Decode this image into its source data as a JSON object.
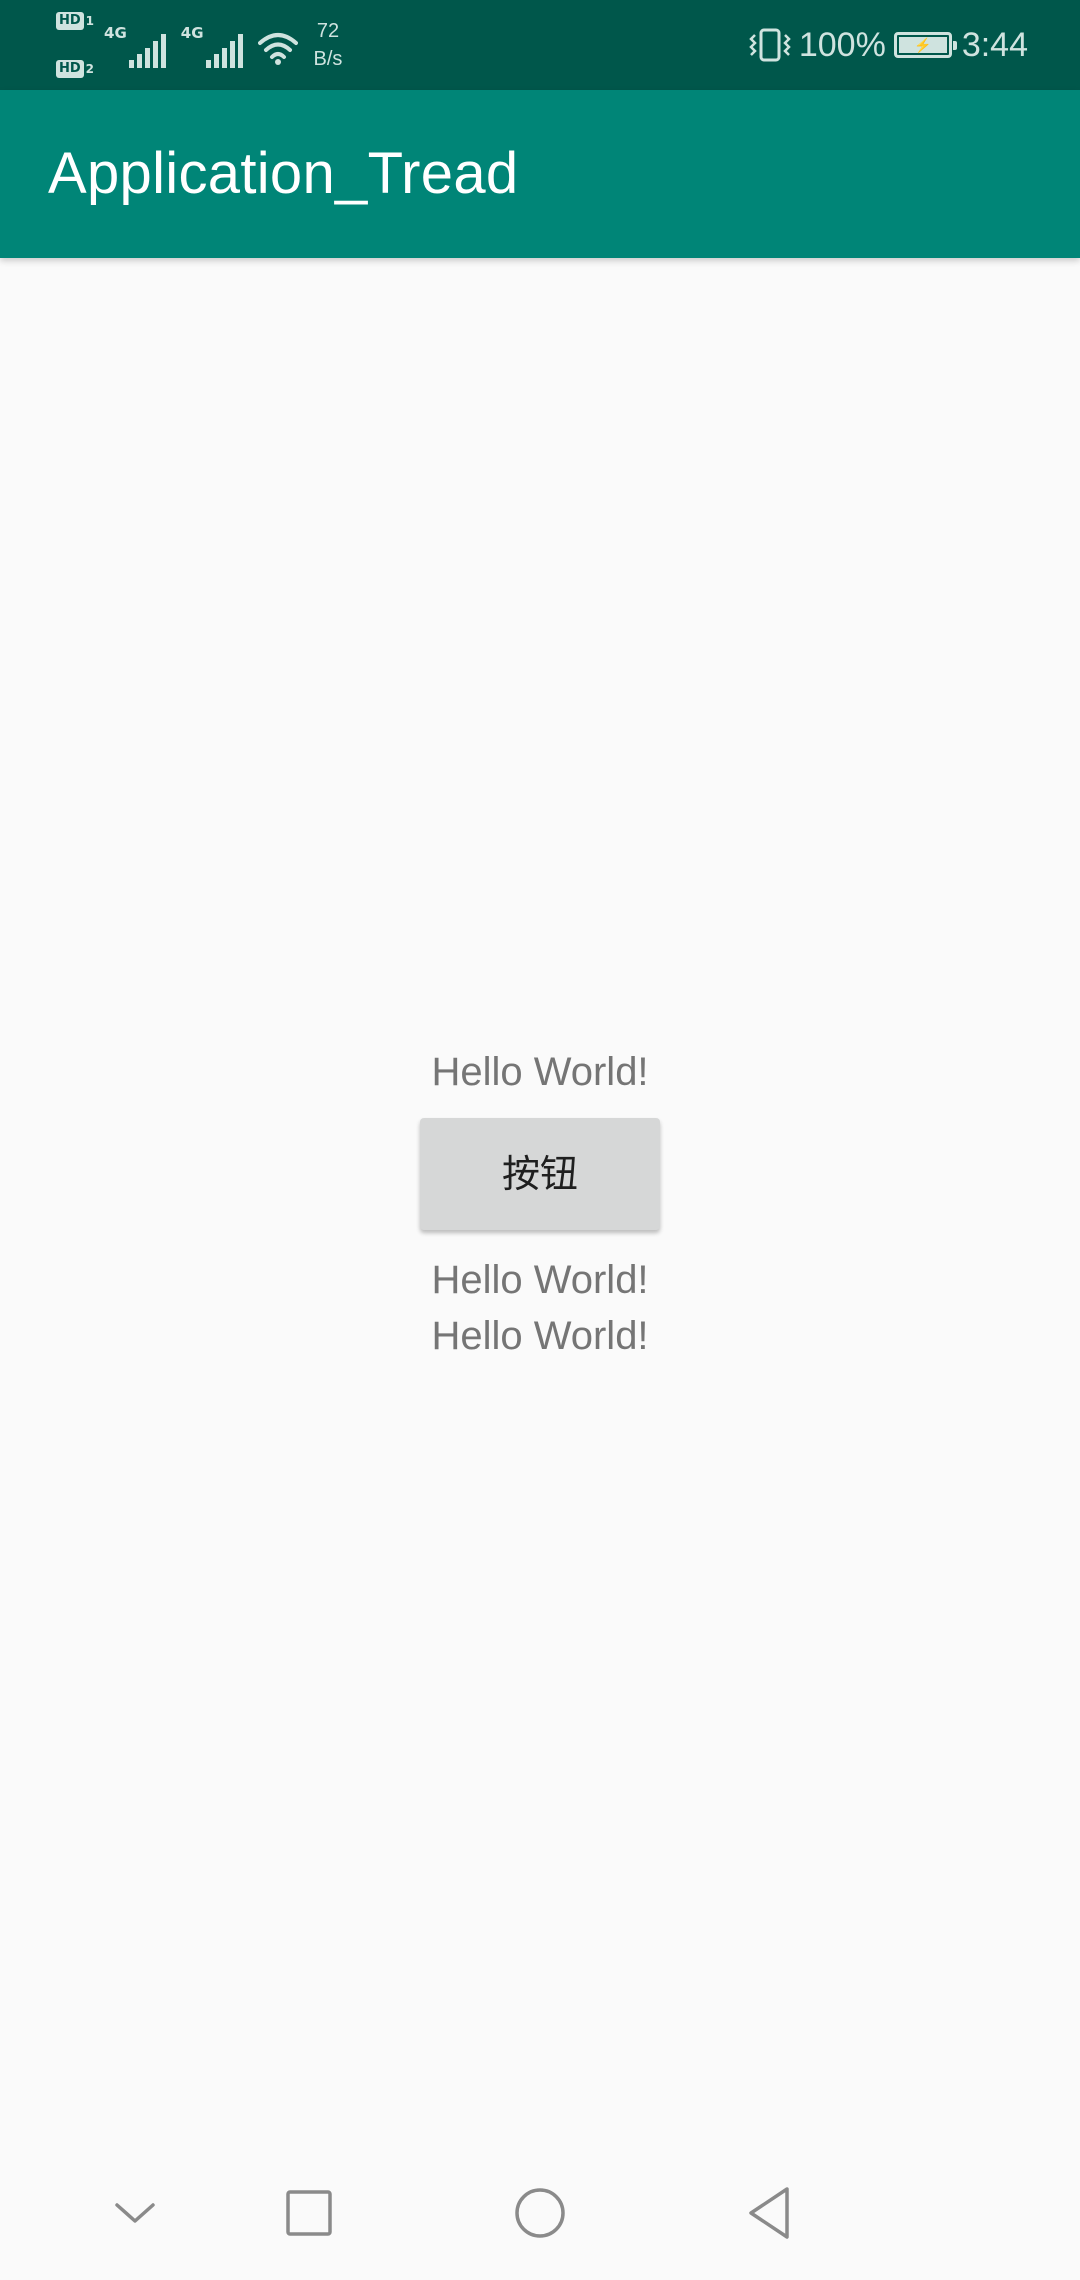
{
  "status_bar": {
    "sim1_label": "HD",
    "sim1_index": "1",
    "sim2_label": "HD",
    "sim2_index": "2",
    "network_1": "4G",
    "network_2": "4G",
    "speed_value": "72",
    "speed_unit": "B/s",
    "battery_percent": "100%",
    "battery_charging": true,
    "time": "3:44",
    "icons": [
      "vibrate-icon",
      "signal-icon",
      "wifi-icon",
      "battery-icon"
    ]
  },
  "app_bar": {
    "title": "Application_Tread",
    "background_color": "#008577"
  },
  "content": {
    "text_1": "Hello World!",
    "button_label": "按钮",
    "text_2": "Hello World!",
    "text_3": "Hello World!"
  },
  "nav_bar": {
    "icons": [
      "chevron-down-icon",
      "recent-apps-icon",
      "home-icon",
      "back-icon"
    ]
  },
  "colors": {
    "status_bar": "#00574b",
    "app_bar": "#008577",
    "background": "#fafafa",
    "button": "#d6d7d7",
    "text_secondary": "#757575"
  }
}
